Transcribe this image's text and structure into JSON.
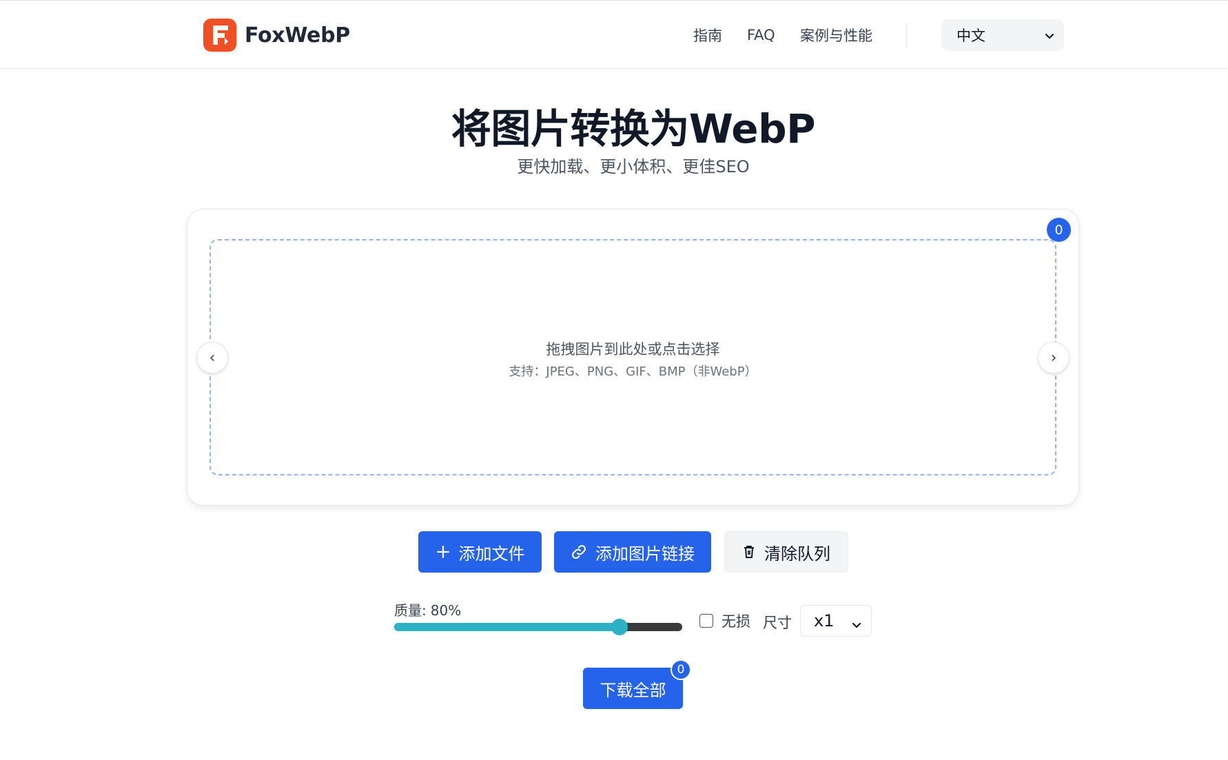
{
  "header": {
    "brand": "FoxWebP",
    "nav": {
      "guide": "指南",
      "faq": "FAQ",
      "cases": "案例与性能"
    },
    "language": "中文"
  },
  "hero": {
    "title": "将图片转换为WebP",
    "subtitle": "更快加载、更小体积、更佳SEO"
  },
  "uploader": {
    "queue_count": "0",
    "drop_text": "拖拽图片到此处或点击选择",
    "supported_text": "支持：JPEG、PNG、GIF、BMP（非WebP）",
    "prev_symbol": "‹",
    "next_symbol": "›"
  },
  "actions": {
    "add_file": "添加文件",
    "add_url": "添加图片链接",
    "clear_queue": "清除队列"
  },
  "settings": {
    "quality_label": "质量:",
    "quality_value": "80%",
    "quality_fraction": 0.8,
    "lossless_label": "无损",
    "lossless_checked": false,
    "size_label": "尺寸",
    "size_value": "x1"
  },
  "download": {
    "label": "下载全部",
    "count": "0"
  },
  "colors": {
    "primary": "#2563eb",
    "brand": "#f04e23",
    "slider_accent": "#2bb3c5"
  },
  "icons": {
    "logo": "foxwebp-logo-icon",
    "chevron": "chevron-down-icon",
    "plus": "plus-icon",
    "link": "link-icon",
    "trash": "trash-icon"
  }
}
